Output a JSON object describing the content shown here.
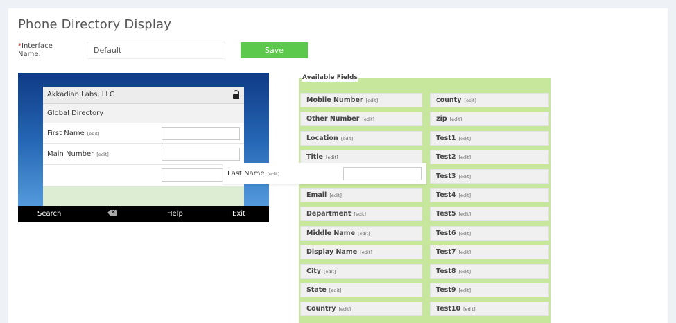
{
  "page": {
    "title": "Phone Directory Display"
  },
  "interface": {
    "required_mark": "*",
    "label": "Interface Name:",
    "value": "Default"
  },
  "toolbar": {
    "save_label": "Save"
  },
  "phone": {
    "header": "Akkadian Labs, LLC",
    "subheader": "Global Directory",
    "fields": [
      {
        "label": "First Name",
        "edit": "[edit]"
      },
      {
        "label": "Main Number",
        "edit": "[edit]"
      }
    ],
    "dragged": {
      "label": "Last Name",
      "edit": "[edit]"
    },
    "softkeys": {
      "search": "Search",
      "help": "Help",
      "exit": "Exit"
    },
    "icons": {
      "lock": "lock-icon",
      "backspace": "backspace-icon"
    }
  },
  "available": {
    "title": "Available Fields",
    "edit": "[edit]",
    "left": [
      "Mobile Number",
      "Other Number",
      "Location",
      "Title",
      "",
      "Email",
      "Department",
      "Middle Name",
      "Display Name",
      "City",
      "State",
      "Country"
    ],
    "right": [
      "county",
      "zip",
      "Test1",
      "Test2",
      "Test3",
      "Test4",
      "Test5",
      "Test6",
      "Test7",
      "Test8",
      "Test9",
      "Test10"
    ]
  },
  "colors": {
    "accent": "#5cc84c",
    "drop_zone": "#c7e79c",
    "required": "#e02020"
  }
}
